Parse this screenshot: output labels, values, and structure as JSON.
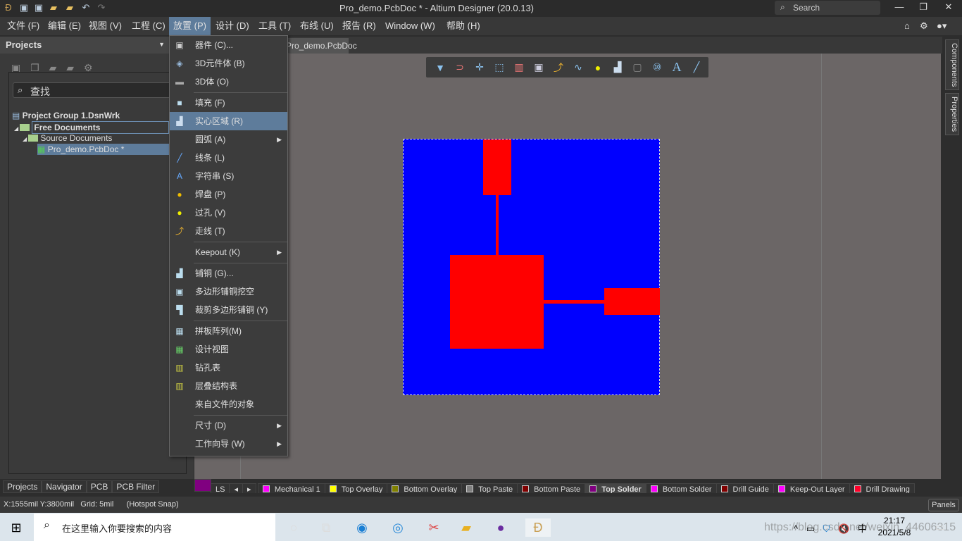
{
  "titlebar": {
    "title": "Pro_demo.PcbDoc * - Altium Designer (20.0.13)",
    "search_placeholder": "Search"
  },
  "menu": [
    "文件 (F)",
    "编辑 (E)",
    "视图 (V)",
    "工程 (C)",
    "放置 (P)",
    "设计 (D)",
    "工具 (T)",
    "布线 (U)",
    "报告 (R)",
    "Window (W)",
    "帮助 (H)"
  ],
  "projects": {
    "title": "Projects",
    "find": "查找",
    "group": "Project Group 1.DsnWrk",
    "free": "Free Documents",
    "source": "Source Documents",
    "doc": "Pro_demo.PcbDoc *"
  },
  "panel_tabs": [
    "Projects",
    "Navigator",
    "PCB",
    "PCB Filter"
  ],
  "doc_tab": "Pro_demo.PcbDoc *",
  "right_tabs": [
    "Components",
    "Properties"
  ],
  "place_menu": [
    {
      "label": "器件 (C)...",
      "icon": "component-icon"
    },
    {
      "label": "3D元件体 (B)",
      "icon": "3d-body-icon"
    },
    {
      "label": "3D体 (O)",
      "icon": "3d-icon"
    },
    {
      "label": "填充 (F)",
      "icon": "fill-icon"
    },
    {
      "label": "实心区域 (R)",
      "icon": "solid-region-icon",
      "highlighted": true
    },
    {
      "label": "圆弧 (A)",
      "submenu": true
    },
    {
      "label": "线条 (L)",
      "icon": "line-icon"
    },
    {
      "label": "字符串 (S)",
      "icon": "string-icon"
    },
    {
      "label": "焊盘 (P)",
      "icon": "pad-icon"
    },
    {
      "label": "过孔 (V)",
      "icon": "via-icon"
    },
    {
      "label": "走线 (T)",
      "icon": "track-icon"
    },
    {
      "label": "Keepout (K)",
      "submenu": true
    },
    {
      "label": "铺铜 (G)...",
      "icon": "polygon-icon"
    },
    {
      "label": "多边形铺铜挖空",
      "icon": "cutout-icon"
    },
    {
      "label": "裁剪多边形铺铜 (Y)",
      "icon": "slice-icon"
    },
    {
      "label": "拼板阵列(M)",
      "icon": "panel-array-icon"
    },
    {
      "label": "设计视图",
      "icon": "design-view-icon"
    },
    {
      "label": "钻孔表",
      "icon": "drill-table-icon"
    },
    {
      "label": "层叠结构表",
      "icon": "layer-stack-icon"
    },
    {
      "label": "来自文件的对象"
    },
    {
      "label": "尺寸 (D)",
      "submenu": true
    },
    {
      "label": "工作向导 (W)",
      "submenu": true
    }
  ],
  "layers": {
    "current_color": "#800080",
    "ls": "LS",
    "tabs": [
      {
        "name": "Mechanical 1",
        "color": "#ff00ff"
      },
      {
        "name": "Top Overlay",
        "color": "#ffff00"
      },
      {
        "name": "Bottom Overlay",
        "color": "#808000"
      },
      {
        "name": "Top Paste",
        "color": "#808080"
      },
      {
        "name": "Bottom Paste",
        "color": "#800000"
      },
      {
        "name": "Top Solder",
        "color": "#800080",
        "active": true
      },
      {
        "name": "Bottom Solder",
        "color": "#ff00ff"
      },
      {
        "name": "Drill Guide",
        "color": "#800000"
      },
      {
        "name": "Keep-Out Layer",
        "color": "#ff00ff"
      },
      {
        "name": "Drill Drawing",
        "color": "#ff002a"
      }
    ]
  },
  "status": {
    "coords": "X:1555mil Y:3800mil",
    "grid": "Grid: 5mil",
    "snap": "(Hotspot Snap)",
    "panels": "Panels"
  },
  "taskbar": {
    "search": "在这里输入你要搜索的内容",
    "time": "21:17",
    "date": "2021/5/8",
    "ime": "中",
    "watermark": "https://blog.csdn.net/weixin_44606315"
  },
  "colors": {
    "board": "#0000ff",
    "copper": "#ff0000",
    "canvas": "#6b6666",
    "accent": "#5e7c9b"
  }
}
